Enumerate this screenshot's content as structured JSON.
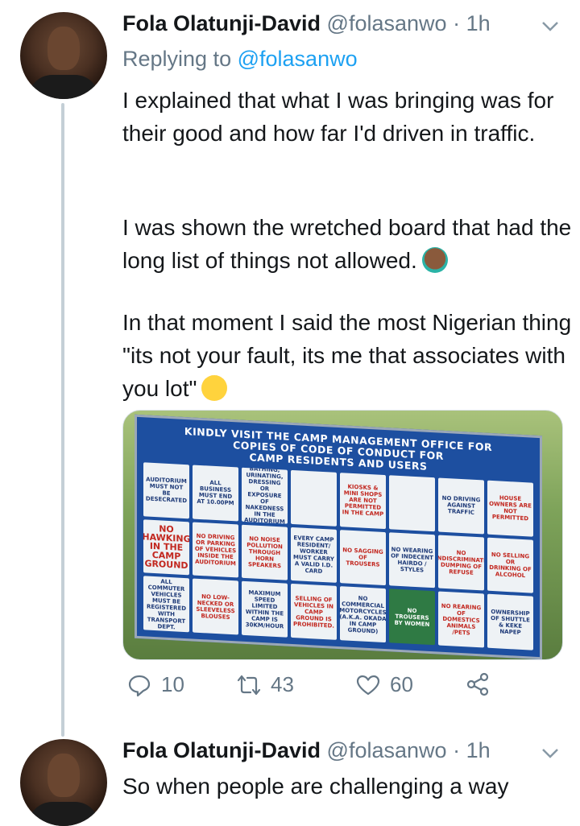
{
  "tweet1": {
    "display_name": "Fola Olatunji-David",
    "handle": "@folasanwo",
    "separator": "·",
    "time": "1h",
    "replying_prefix": "Replying to",
    "replying_handle": "@folasanwo",
    "paragraphs": [
      "I explained that what I was bringing was for their good and how far I'd driven in traffic.",
      "I was shown the wretched board that had the long list of things not allowed.",
      "In that moment I said the most Nigerian thing \"its not your fault, its me that associates with you lot\""
    ],
    "board_title_lines": [
      "KINDLY VISIT THE CAMP MANAGEMENT OFFICE FOR",
      "COPIES OF CODE OF CONDUCT FOR",
      "CAMP RESIDENTS AND USERS"
    ],
    "board_cells": [
      "AUDITORIUM MUST NOT BE DESECRATED",
      "ALL BUSINESS MUST END AT 10.00PM",
      "LIVING, COOKING, BATHING, URINATING, DRESSING OR EXPOSURE OF NAKEDNESS IN THE AUDITORIUM IS PROHIBITED",
      "",
      "KIOSKS & MINI SHOPS ARE NOT PERMITTED IN THE CAMP",
      "",
      "NO DRIVING AGAINST TRAFFIC",
      "HOUSE OWNERS ARE NOT PERMITTED",
      "NO HAWKING IN THE CAMP GROUND",
      "NO DRIVING OR PARKING OF VEHICLES INSIDE THE AUDITORIUM",
      "NO NOISE POLLUTION THROUGH HORN SPEAKERS",
      "EVERY CAMP RESIDENT/ WORKER MUST CARRY A VALID I.D. CARD",
      "NO SAGGING OF TROUSERS",
      "NO WEARING OF INDECENT HAIRDO / STYLES",
      "NO INDISCRIMINATE DUMPING OF REFUSE",
      "NO SELLING OR DRINKING OF ALCOHOL",
      "ALL COMMUTER VEHICLES MUST BE REGISTERED WITH TRANSPORT DEPT.",
      "NO LOW-NECKED OR SLEEVELESS BLOUSES",
      "MAXIMUM SPEED LIMITED WITHIN THE CAMP IS 30KM/HOUR",
      "SELLING OF VEHICLES IN CAMP GROUND IS PROHIBITED.",
      "NO COMMERCIAL MOTORCYCLES (A.K.A. OKADA IN CAMP GROUND)",
      "NO TROUSERS BY WOMEN",
      "NO REARING OF DOMESTICS ANIMALS /PETS",
      "OWNERSHIP OF SHUTTLE & KEKE NAPEP"
    ],
    "reply_count": "10",
    "retweet_count": "43",
    "like_count": "60"
  },
  "tweet2": {
    "display_name": "Fola Olatunji-David",
    "handle": "@folasanwo",
    "separator": "·",
    "time": "1h",
    "text": "So when people are challenging a way"
  },
  "colors": {
    "link": "#1da1f2",
    "muted": "#657786",
    "text": "#14171a",
    "thread_line": "#c4cfd6"
  },
  "icons": {
    "reply": "reply-icon",
    "retweet": "retweet-icon",
    "like": "heart-icon",
    "share": "share-icon",
    "caret": "chevron-down-icon",
    "emoji1": "facepalm-emoji-icon",
    "emoji2": "laughing-face-emoji-icon"
  }
}
